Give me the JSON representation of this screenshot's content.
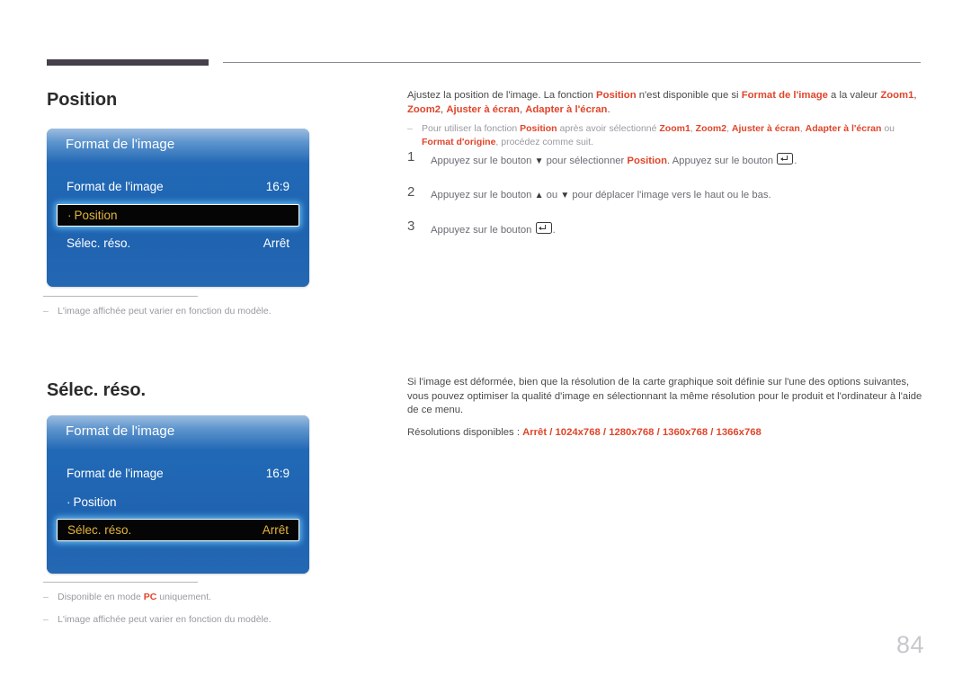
{
  "page": {
    "number": "84"
  },
  "sections": [
    {
      "heading": "Position",
      "osd": {
        "title": "Format de l'image",
        "rows": [
          {
            "label": "Format de l'image",
            "value": "16:9",
            "selected": false,
            "sub": false
          },
          {
            "label": "Position",
            "value": "",
            "selected": true,
            "sub": true
          },
          {
            "label": "Sélec. réso.",
            "value": "Arrêt",
            "selected": false,
            "sub": false
          }
        ]
      },
      "notes": [
        {
          "dash": "–",
          "text": "L'image affichée peut varier en fonction du modèle."
        }
      ],
      "body": {
        "para_1": {
          "p1": "Ajustez la position de l'image. La fonction ",
          "hl1": "Position",
          "p2": " n'est disponible que si ",
          "hl2": "Format de l'image",
          "p3": " a la valeur ",
          "hl3": "Zoom1",
          "p4": ", ",
          "hl4": "Zoom2",
          "p5": ", ",
          "hl5": "Ajuster à écran",
          "p6": ", ",
          "hl6": "Adapter à l'écran",
          "p7": "."
        },
        "subnote": {
          "dash": "–",
          "s1": "Pour utiliser la fonction ",
          "hl1": "Position",
          "s2": " après avoir sélectionné ",
          "hl2": "Zoom1",
          "s3": ", ",
          "hl3": "Zoom2",
          "s4": ", ",
          "hl4": "Ajuster à écran",
          "s5": ", ",
          "hl5": "Adapter à l'écran",
          "s6": " ou ",
          "hl6": "Format d'origine",
          "s7": ", procédez comme suit."
        },
        "steps": [
          {
            "num": "1",
            "t1": "Appuyez sur le bouton ",
            "arrow1": "▼",
            "t2": " pour sélectionner ",
            "hl": "Position",
            "t3": ". Appuyez sur le bouton ",
            "t4": "."
          },
          {
            "num": "2",
            "t1": "Appuyez sur le bouton ",
            "arrow1": "▲",
            "t2": " ou ",
            "arrow2": "▼",
            "t3": " pour déplacer l'image vers le haut ou le bas."
          },
          {
            "num": "3",
            "t1": "Appuyez sur le bouton ",
            "t2": "."
          }
        ]
      }
    },
    {
      "heading": "Sélec. réso.",
      "osd": {
        "title": "Format de l'image",
        "rows": [
          {
            "label": "Format de l'image",
            "value": "16:9",
            "selected": false,
            "sub": false
          },
          {
            "label": "Position",
            "value": "",
            "selected": false,
            "sub": true
          },
          {
            "label": "Sélec. réso.",
            "value": "Arrêt",
            "selected": true,
            "sub": false
          }
        ]
      },
      "notes": [
        {
          "dash": "–",
          "text_1": "Disponible en mode ",
          "hl": "PC",
          "text_2": " uniquement."
        },
        {
          "dash": "–",
          "text": "L'image affichée peut varier en fonction du modèle."
        }
      ],
      "body": {
        "para_1": "Si l'image est déformée, bien que la résolution de la carte graphique soit définie sur l'une des options suivantes, vous pouvez optimiser la qualité d'image en sélectionnant la même résolution pour le produit et l'ordinateur à l'aide de ce menu.",
        "para_2": {
          "label": "Résolutions disponibles : ",
          "options": [
            "Arrêt",
            "1024x768",
            "1280x768",
            "1360x768",
            "1366x768"
          ],
          "separator": " / "
        }
      }
    }
  ],
  "colors": {
    "accent_orange": "#e0452a",
    "osd_blue": "#1f63b0",
    "osd_header_light": "#9dbde0",
    "highlight_text": "#e4b53e",
    "highlight_bg": "#050505",
    "rule_dark": "#45404c",
    "note_gray": "#9b98a1",
    "page_number_gray": "#c9c7cd"
  }
}
